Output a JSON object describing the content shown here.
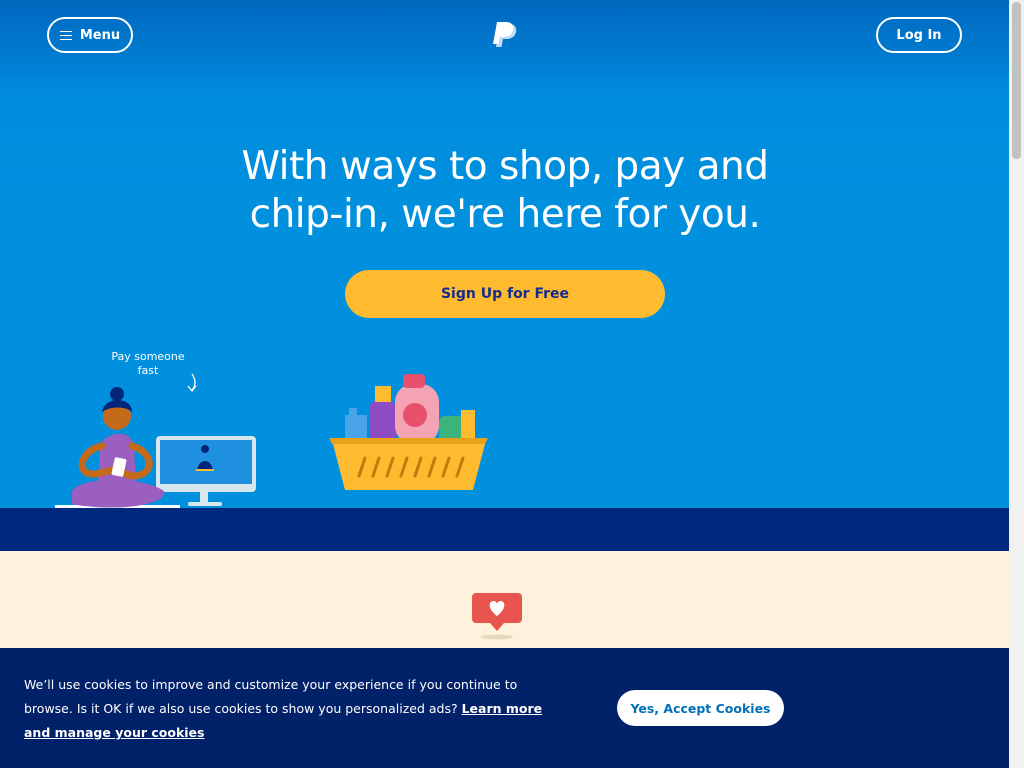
{
  "header": {
    "menu_label": "Menu",
    "login_label": "Log In",
    "logo_icon": "paypal-logo-icon",
    "menu_icon": "hamburger-icon"
  },
  "hero": {
    "title": "With ways to shop, pay and chip-in, we're here for you.",
    "signup_label": "Sign Up for Free",
    "callout": "Pay someone fast"
  },
  "cookie_banner": {
    "text": "We’ll use cookies to improve and customize your experience if you continue to browse. Is it OK if we also use cookies to show you personalized ads? ",
    "link_text": "Learn more and manage your cookies",
    "accept_label": "Yes, Accept Cookies"
  },
  "colors": {
    "hero_blue": "#0090de",
    "navy": "#012169",
    "cta_yellow": "#ffbb2f",
    "cream": "#fff2dc"
  }
}
